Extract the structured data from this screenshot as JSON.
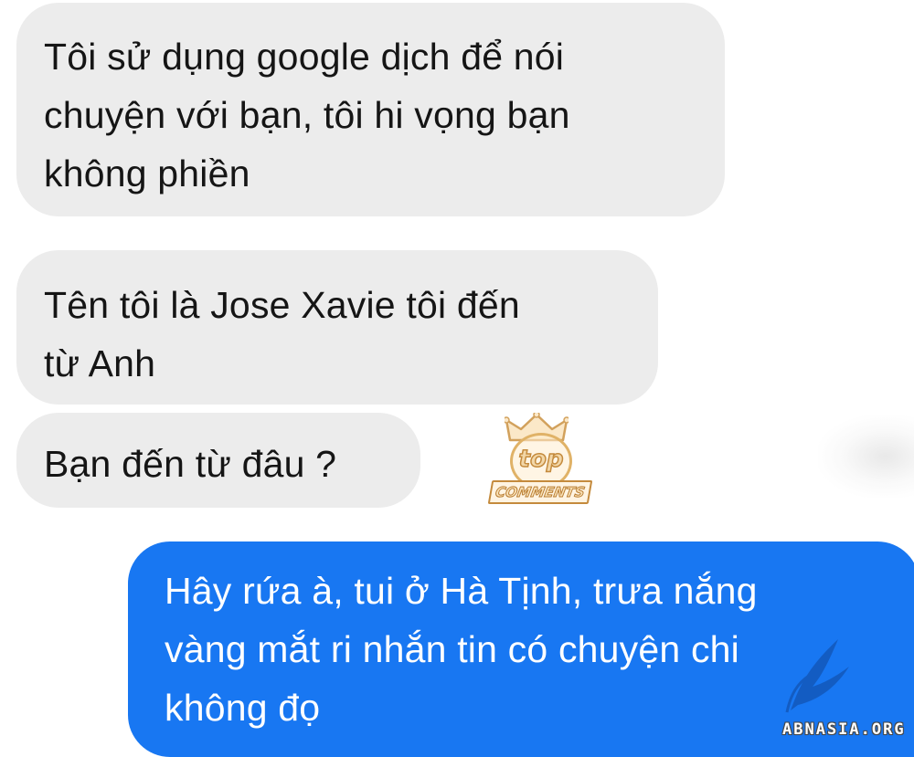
{
  "conversation": {
    "messages": [
      {
        "direction": "incoming",
        "text": "Tôi sử dụng google dịch để nói\nchuyện với bạn, tôi hi vọng bạn\nkhông phiền"
      },
      {
        "direction": "incoming",
        "text": "Tên tôi là Jose Xavie tôi đến\ntừ Anh"
      },
      {
        "direction": "incoming",
        "text": "Bạn đến từ đâu ?"
      },
      {
        "direction": "outgoing",
        "text": "Hây rứa à, tui ở Hà Tịnh, trưa nắng\nvàng mắt ri nhắn tin có chuyện chi\nkhông đọ"
      }
    ]
  },
  "watermarks": {
    "logo_top": "top",
    "logo_banner": "COMMENTS",
    "site": "ABNASIA.ORG"
  },
  "colors": {
    "incoming_bubble": "#ececec",
    "outgoing_bubble": "#1877f2",
    "incoming_text": "#151515",
    "outgoing_text": "#ffffff"
  }
}
